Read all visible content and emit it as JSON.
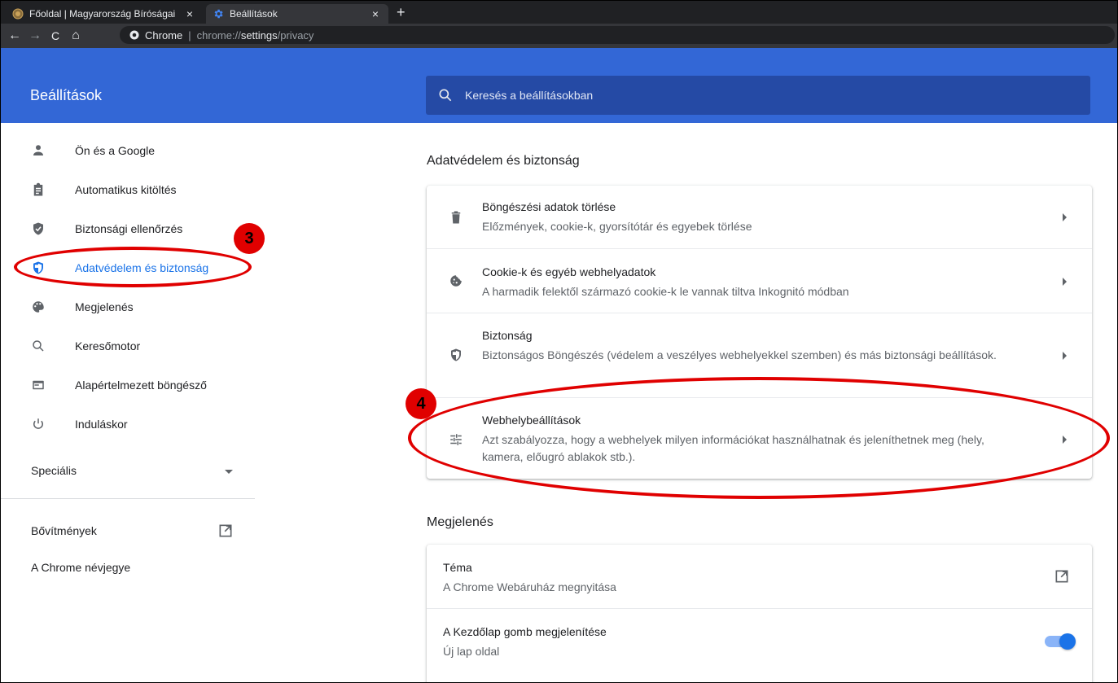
{
  "browser": {
    "tabs": [
      {
        "title": "Főoldal | Magyarország Bíróságai",
        "close": "×",
        "active": false,
        "favicon": "court-seal-icon"
      },
      {
        "title": "Beállítások",
        "close": "×",
        "active": true,
        "favicon": "gear-icon"
      }
    ],
    "new_tab": "+",
    "nav": {
      "back": "←",
      "forward": "→",
      "reload": "C",
      "home": "⌂"
    },
    "omnibox": {
      "site_label": "Chrome",
      "separator": "|",
      "url_scheme": "chrome://",
      "url_host": "settings",
      "url_path": "/privacy"
    }
  },
  "header": {
    "title": "Beállítások",
    "search_placeholder": "Keresés a beállításokban"
  },
  "sidebar": {
    "items": [
      {
        "label": "Ön és a Google",
        "icon": "person-icon"
      },
      {
        "label": "Automatikus kitöltés",
        "icon": "clipboard-icon"
      },
      {
        "label": "Biztonsági ellenőrzés",
        "icon": "shield-check-icon"
      },
      {
        "label": "Adatvédelem és biztonság",
        "icon": "shield-privacy-icon",
        "selected": true
      },
      {
        "label": "Megjelenés",
        "icon": "palette-icon"
      },
      {
        "label": "Keresőmotor",
        "icon": "search-icon"
      },
      {
        "label": "Alapértelmezett böngésző",
        "icon": "browser-window-icon"
      },
      {
        "label": "Induláskor",
        "icon": "power-icon"
      }
    ],
    "advanced_label": "Speciális",
    "extensions_label": "Bővítmények",
    "about_label": "A Chrome névjegye"
  },
  "main": {
    "privacy": {
      "title": "Adatvédelem és biztonság",
      "rows": [
        {
          "title": "Böngészési adatok törlése",
          "subtitle": "Előzmények, cookie-k, gyorsítótár és egyebek törlése",
          "icon": "trash-icon"
        },
        {
          "title": "Cookie-k és egyéb webhelyadatok",
          "subtitle": "A harmadik felektől származó cookie-k le vannak tiltva Inkognitó módban",
          "icon": "cookie-icon"
        },
        {
          "title": "Biztonság",
          "subtitle": "Biztonságos Böngészés (védelem a veszélyes webhelyekkel szemben) és más biztonsági beállítások.",
          "icon": "shield-icon"
        },
        {
          "title": "Webhelybeállítások",
          "subtitle": "Azt szabályozza, hogy a webhelyek milyen információkat használhatnak és jeleníthetnek meg (hely, kamera, előugró ablakok stb.).",
          "icon": "tune-sliders-icon"
        }
      ]
    },
    "appearance": {
      "title": "Megjelenés",
      "rows": [
        {
          "title": "Téma",
          "subtitle": "A Chrome Webáruház megnyitása",
          "icon": "open-external-icon"
        },
        {
          "title": "A Kezdőlap gomb megjelenítése",
          "subtitle": "Új lap oldal",
          "toggle_on": true
        }
      ]
    }
  },
  "annotations": {
    "badge_3": "3",
    "badge_4": "4",
    "color": "#e00000"
  },
  "colors": {
    "header_blue": "#3367d6",
    "search_bg": "#254aa5",
    "selected_blue": "#1a73e8"
  }
}
